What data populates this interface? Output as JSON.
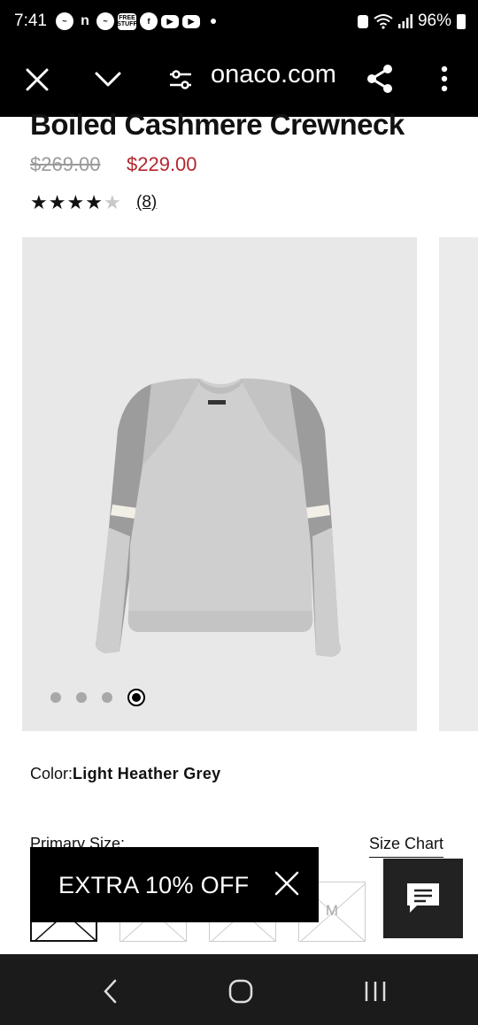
{
  "status_bar": {
    "time": "7:41",
    "battery_percent": "96%",
    "notification_icons": [
      "messenger-icon",
      "n-icon",
      "messenger-icon",
      "free-stuff-icon",
      "facebook-icon",
      "youtube-icon",
      "youtube-icon"
    ],
    "free_stuff_label": "FREE STUFF"
  },
  "browser": {
    "url": "onaco.com",
    "close_icon": "close-icon",
    "dropdown_icon": "chevron-down-icon",
    "site_settings_icon": "tune-icon",
    "share_icon": "share-icon",
    "menu_icon": "more-vert-icon"
  },
  "product": {
    "title": "Boiled Cashmere Crewneck",
    "original_price": "$269.00",
    "sale_price": "$229.00",
    "rating": 4,
    "rating_max": 5,
    "review_count": "(8)",
    "gallery": {
      "image_count": 4,
      "active_index": 3
    },
    "color_label": "Color:",
    "color_value": "Light Heather Grey",
    "size_label": "Primary Size:",
    "size_chart_link": "Size Chart",
    "size_options": [
      "",
      "",
      "",
      "M"
    ]
  },
  "promo": {
    "text": "EXTRA 10% OFF"
  },
  "colors": {
    "sale_red": "#b4262f",
    "black": "#000000",
    "image_bg": "#e8e8e8"
  }
}
